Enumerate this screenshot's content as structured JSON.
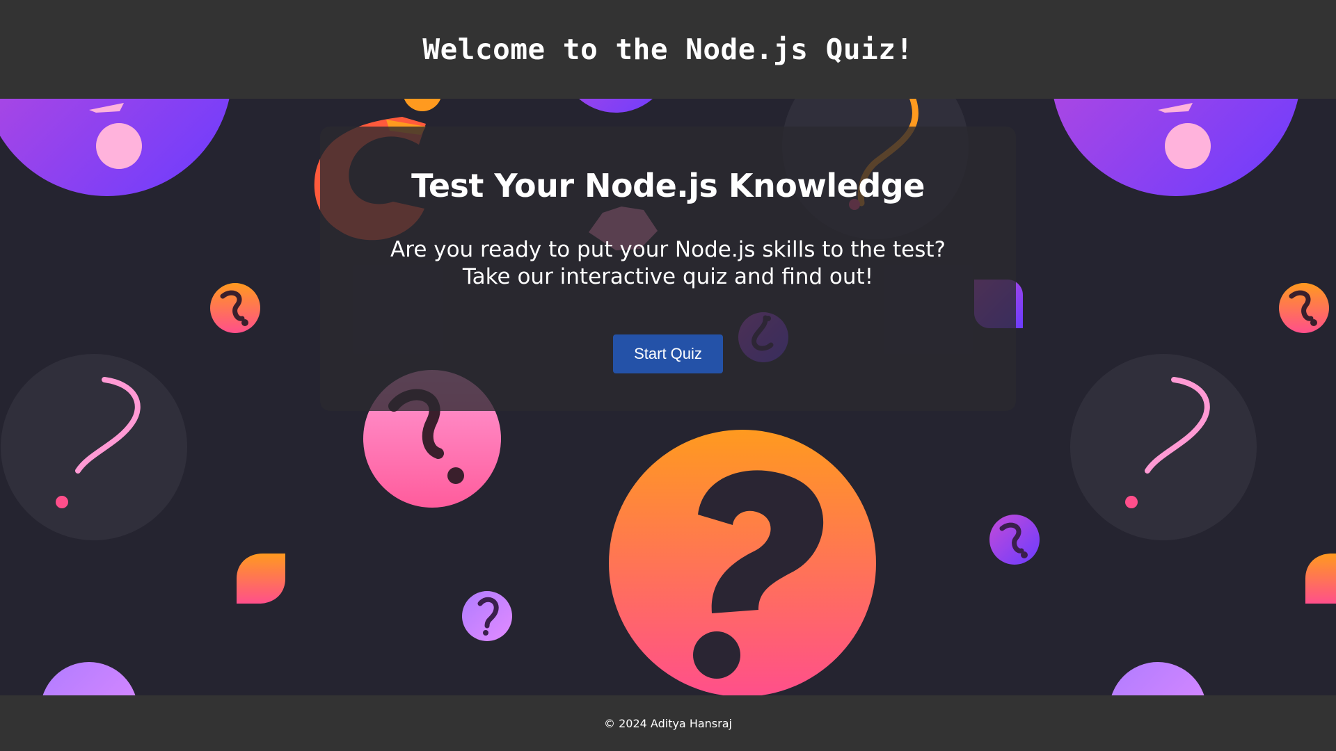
{
  "header": {
    "title": "Welcome to the Node.js Quiz!"
  },
  "card": {
    "heading": "Test Your Node.js Knowledge",
    "description_line1": "Are you ready to put your Node.js skills to the test?",
    "description_line2": "Take our interactive quiz and find out!",
    "start_button": "Start Quiz"
  },
  "footer": {
    "copyright": "© 2024 Aditya Hansraj"
  },
  "colors": {
    "header_bg": "#333333",
    "page_bg": "#252430",
    "button_bg": "#2452a8",
    "accent_orange": "#ff9a1f",
    "accent_pink": "#ff4f8b",
    "accent_purple": "#7b3cff"
  },
  "background": {
    "decoration": "question-mark-pattern"
  }
}
